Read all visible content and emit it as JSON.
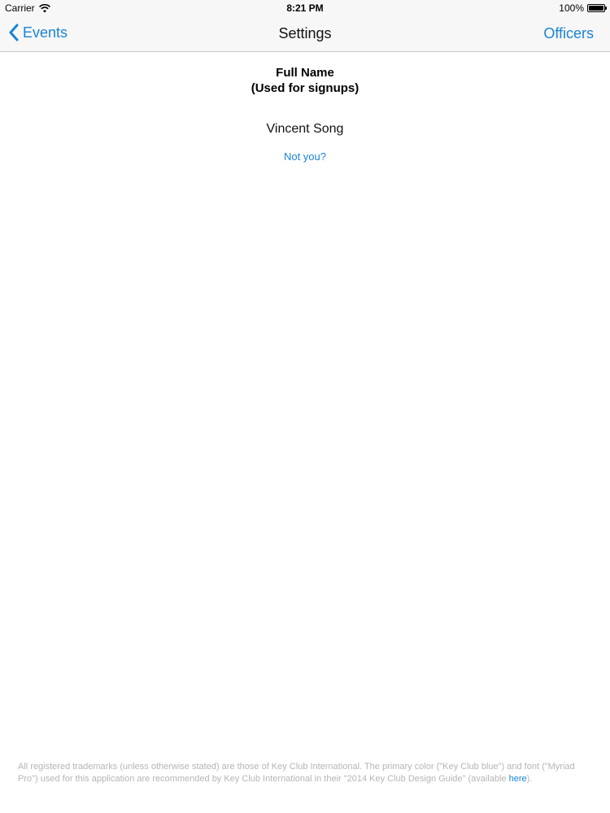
{
  "status_bar": {
    "carrier": "Carrier",
    "time": "8:21 PM",
    "battery": "100%"
  },
  "nav": {
    "back_label": "Events",
    "title": "Settings",
    "right_label": "Officers",
    "accent_color": "#1a84d6"
  },
  "content": {
    "heading_line1": "Full Name",
    "heading_line2": "(Used for signups)",
    "user_name": "Vincent Song",
    "not_you_link": "Not you?"
  },
  "footer": {
    "text": "All registered trademarks (unless otherwise stated) are those of Key Club International. The primary color (\"Key Club blue\") and font (\"Myriad Pro\") used for this application are recommended by Key Club International in their \"2014 Key Club Design Guide\" (available ",
    "link_label": "here",
    "suffix": ")."
  },
  "icons": {
    "wifi": "wifi-icon",
    "battery": "battery-icon",
    "back": "chevron-left-icon"
  }
}
